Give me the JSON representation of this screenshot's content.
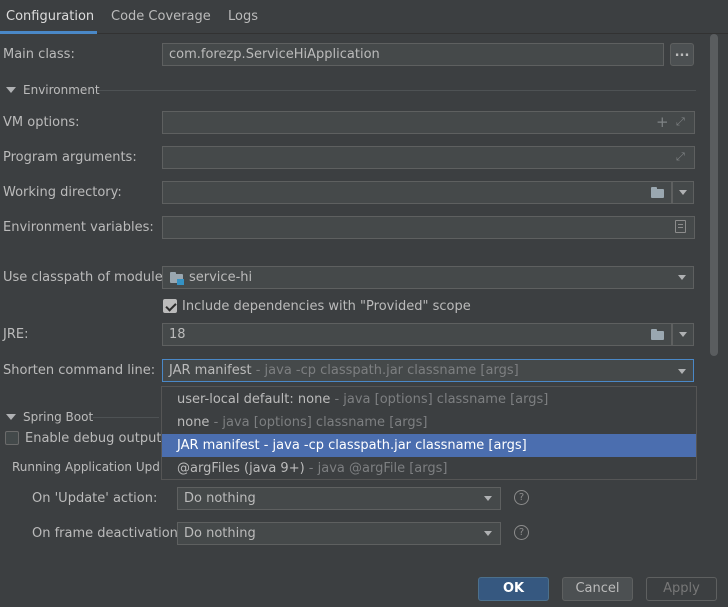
{
  "tabs": [
    {
      "label": "Configuration",
      "active": true
    },
    {
      "label": "Code Coverage",
      "active": false
    },
    {
      "label": "Logs",
      "active": false
    }
  ],
  "main_class": {
    "label": "Main class:",
    "value": "com.forezp.ServiceHiApplication",
    "browse_label": "..."
  },
  "environment": {
    "title": "Environment",
    "vm_options_label": "VM options:",
    "vm_options_value": "",
    "program_args_label": "Program arguments:",
    "program_args_value": "",
    "working_dir_label": "Working directory:",
    "working_dir_value": "",
    "env_vars_label": "Environment variables:",
    "env_vars_value": ""
  },
  "classpath": {
    "label": "Use classpath of module:",
    "value": "service-hi"
  },
  "include_deps": {
    "label": "Include dependencies with \"Provided\" scope",
    "checked": true
  },
  "jre": {
    "label": "JRE:",
    "value": "18"
  },
  "shorten": {
    "label": "Shorten command line:",
    "value_main": "JAR manifest",
    "value_sub": " - java -cp classpath.jar classname [args]",
    "options": [
      {
        "main": "user-local default: none",
        "sub": " - java [options] classname [args]",
        "selected": false
      },
      {
        "main": "none",
        "sub": " - java [options] classname [args]",
        "selected": false
      },
      {
        "main": "JAR manifest - java -cp classpath.jar classname [args]",
        "sub": "",
        "selected": true
      },
      {
        "main": "@argFiles (java 9+)",
        "sub": " - java @argFile [args]",
        "selected": false
      }
    ]
  },
  "spring_boot": {
    "title": "Spring Boot",
    "debug_label": "Enable debug output",
    "debug_checked": false,
    "running_update_label": "Running Application Update",
    "on_update_label": "On 'Update' action:",
    "on_update_value": "Do nothing",
    "on_frame_label": "On frame deactivation:",
    "on_frame_value": "Do nothing",
    "help_glyph": "?"
  },
  "buttons": {
    "ok": "OK",
    "cancel": "Cancel",
    "apply": "Apply"
  },
  "icons": [
    "expand-icon",
    "add-icon",
    "folder-icon",
    "document-icon",
    "chevron-down-icon",
    "help-icon"
  ]
}
